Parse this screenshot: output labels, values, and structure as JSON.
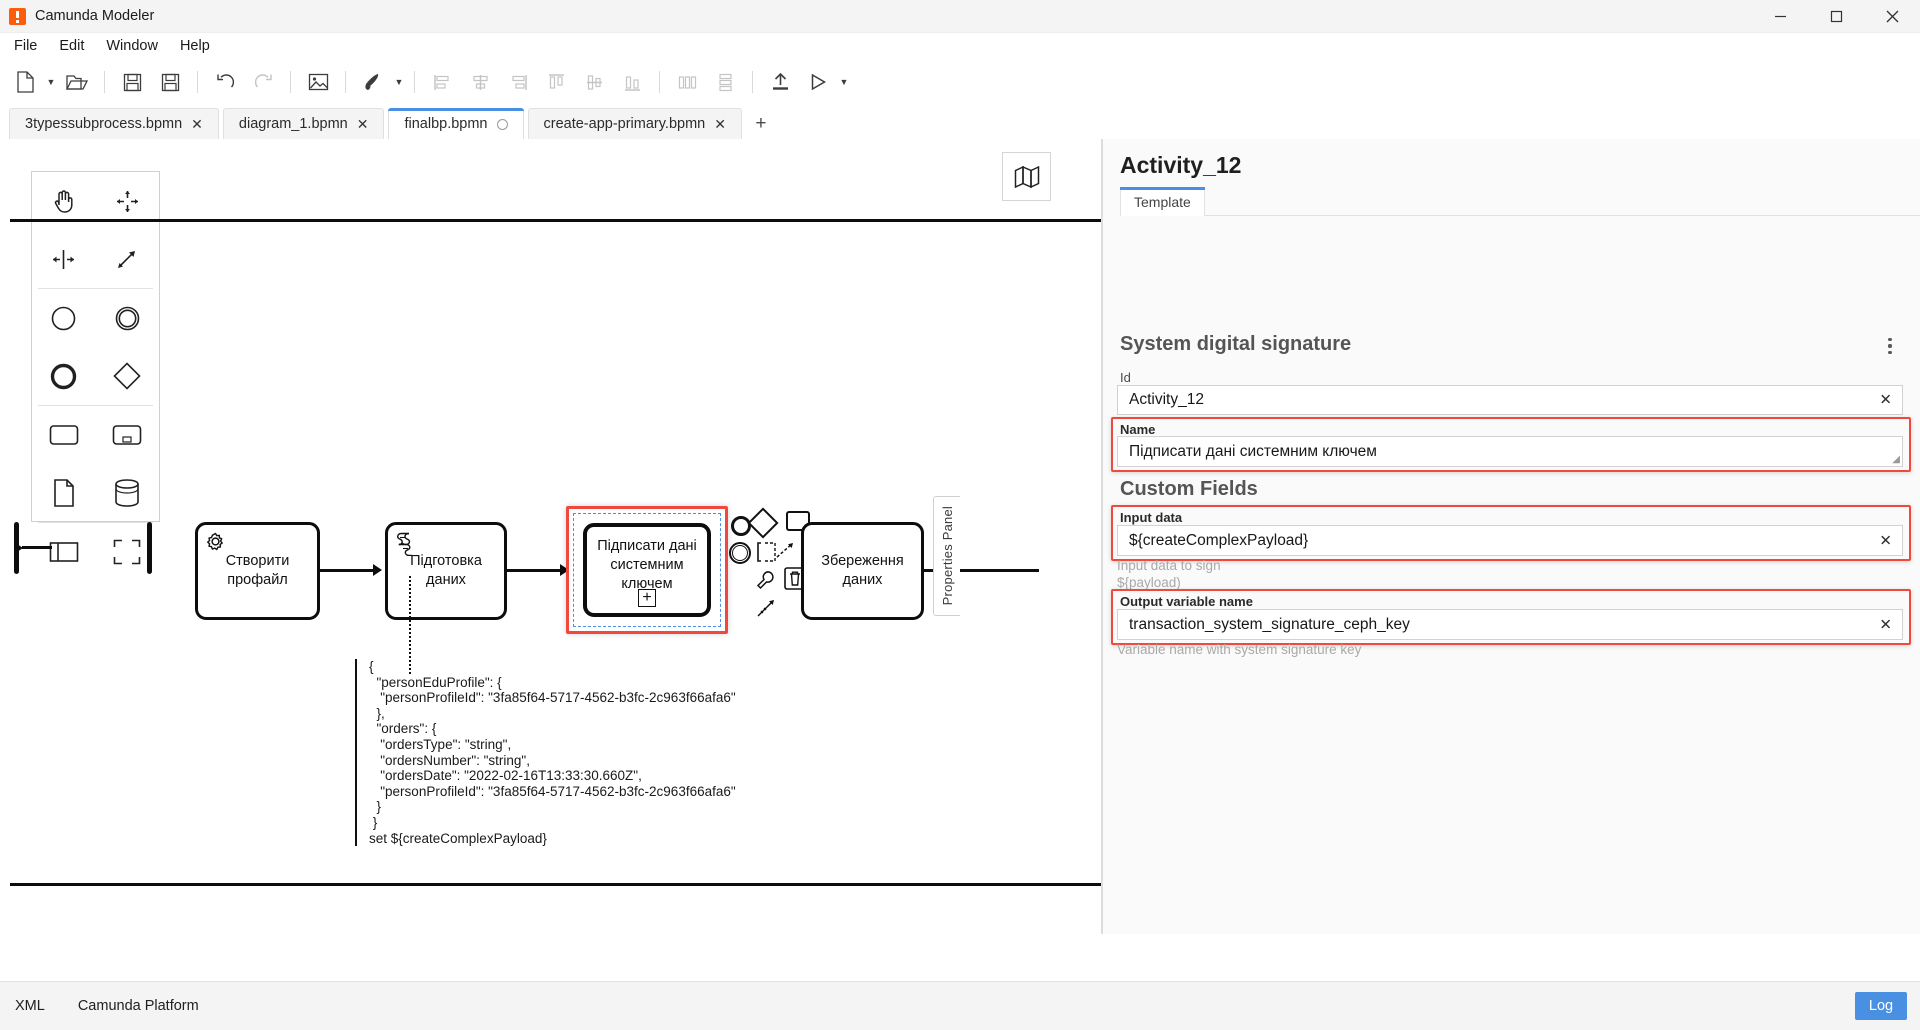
{
  "window": {
    "title": "Camunda Modeler",
    "icon": "camunda-logo-icon",
    "minimize": "minimize-icon",
    "maximize": "maximize-icon",
    "close": "close-icon"
  },
  "menubar": {
    "items": [
      "File",
      "Edit",
      "Window",
      "Help"
    ]
  },
  "toolbar": {
    "buttons": [
      "new-file-icon",
      "open-file-icon",
      "save-icon",
      "save-as-icon",
      "undo-icon",
      "redo-icon",
      "export-image-icon",
      "format-brush-icon",
      "align-left-icon",
      "align-center-icon",
      "align-right-icon",
      "align-top-icon",
      "align-middle-icon",
      "align-bottom-icon",
      "distribute-horizontal-icon",
      "distribute-vertical-icon",
      "deploy-icon",
      "run-icon"
    ]
  },
  "tabs": {
    "items": [
      {
        "label": "3typessubprocess.bpmn",
        "close": "✕",
        "active": false,
        "dirty": false
      },
      {
        "label": "diagram_1.bpmn",
        "close": "✕",
        "active": false,
        "dirty": false
      },
      {
        "label": "finalbp.bpmn",
        "close": "",
        "active": true,
        "dirty": true
      },
      {
        "label": "create-app-primary.bpmn",
        "close": "✕",
        "active": false,
        "dirty": false
      }
    ],
    "add_label": "+"
  },
  "canvas": {
    "minimap_icon": "map-icon",
    "palette": [
      "hand-tool-icon",
      "lasso-tool-icon",
      "space-tool-icon",
      "connect-tool-icon",
      "start-event-icon",
      "intermediate-event-icon",
      "end-event-icon",
      "gateway-icon",
      "task-icon",
      "expanded-subprocess-icon",
      "data-object-icon",
      "data-store-icon",
      "participant-icon",
      "group-icon"
    ],
    "nodes": [
      {
        "id": "task-create-profile",
        "label": "Створити\nпрофайл",
        "icon": "service-task-gear-icon"
      },
      {
        "id": "task-prepare-data",
        "label": "Підготовка\nданих",
        "icon": "script-task-icon"
      },
      {
        "id": "task-sign-data",
        "label": "Підписати дані\nсистемним\nключем",
        "icon": "",
        "marker": "+",
        "selected": true
      },
      {
        "id": "task-save-data",
        "label": "Збереження\nданих",
        "icon": ""
      }
    ],
    "annotation": "{\n  \"personEduProfile\": {\n   \"personProfileId\": \"3fa85f64-5717-4562-b3fc-2c963f66afa6\"\n  },\n  \"orders\": {\n   \"ordersType\": \"string\",\n   \"ordersNumber\": \"string\",\n   \"ordersDate\": \"2022-02-16T13:33:30.660Z\",\n   \"personProfileId\": \"3fa85f64-5717-4562-b3fc-2c963f66afa6\"\n  }\n }\nset ${createComplexPayload}",
    "properties_handle": "Properties Panel",
    "context_pad": [
      "append-end-event-icon",
      "append-intermediate-event-icon",
      "append-gateway-icon",
      "append-task-icon",
      "append-text-annotation-icon",
      "connect-icon",
      "delete-icon",
      "wrench-icon",
      "change-type-icon"
    ]
  },
  "properties": {
    "title": "Activity_12",
    "tab": "Template",
    "group_title": "System digital signature",
    "menu_icon": "kebab-menu-icon",
    "custom_fields_title": "Custom Fields",
    "fields": [
      {
        "label": "Id",
        "value": "Activity_12",
        "clear": "✕",
        "helper": "",
        "highlighted": false,
        "name": "id-field"
      },
      {
        "label": "Name",
        "value": "Підписати дані системним ключем",
        "clear": "",
        "helper": "",
        "highlighted": true,
        "name": "name-field"
      },
      {
        "label": "Input data",
        "value": "${createComplexPayload}",
        "clear": "✕",
        "helper": "Input data to sign\n${payload)",
        "highlighted": true,
        "name": "input-data-field"
      },
      {
        "label": "Output variable name",
        "value": "transaction_system_signature_ceph_key",
        "clear": "✕",
        "helper": "Variable name with system signature key",
        "highlighted": true,
        "name": "output-variable-name-field"
      }
    ]
  },
  "statusbar": {
    "xml_label": "XML",
    "platform_label": "Camunda Platform",
    "log_label": "Log"
  },
  "colors": {
    "accent": "#4a90e2",
    "brand": "#fc5d0d",
    "highlight": "#f2493d",
    "panel_bg": "#fafafa"
  }
}
